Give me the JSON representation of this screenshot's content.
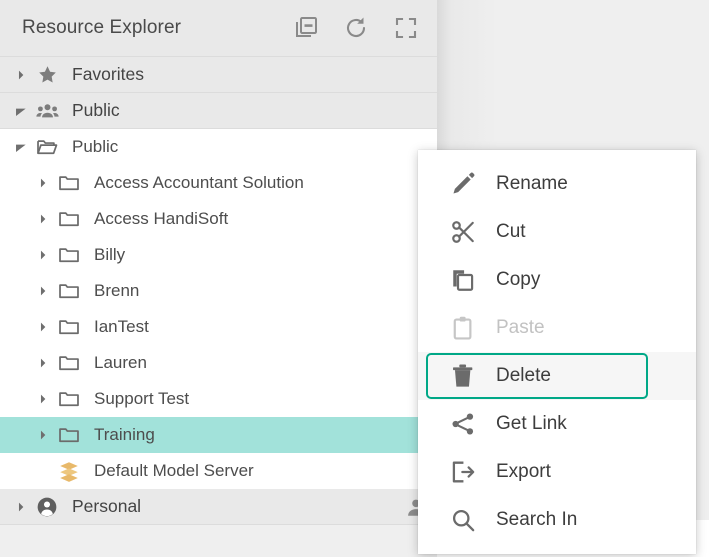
{
  "panel": {
    "title": "Resource Explorer",
    "tools": [
      {
        "name": "collapse-all-icon",
        "label": "Collapse All"
      },
      {
        "name": "refresh-icon",
        "label": "Refresh"
      },
      {
        "name": "fullscreen-icon",
        "label": "Full Screen"
      }
    ]
  },
  "tree": [
    {
      "label": "Favorites",
      "icon": "star-icon",
      "level": 0,
      "expanded": false,
      "has_twisty": true,
      "selected": false
    },
    {
      "label": "Public",
      "icon": "group-icon",
      "level": 0,
      "expanded": true,
      "has_twisty": true,
      "selected": false
    },
    {
      "label": "Public",
      "icon": "folder-open-icon",
      "level": 1,
      "expanded": true,
      "has_twisty": true,
      "selected": false
    },
    {
      "label": "Access Accountant Solution",
      "icon": "folder-icon",
      "level": 2,
      "expanded": false,
      "has_twisty": true,
      "selected": false
    },
    {
      "label": "Access HandiSoft",
      "icon": "folder-icon",
      "level": 2,
      "expanded": false,
      "has_twisty": true,
      "selected": false
    },
    {
      "label": "Billy",
      "icon": "folder-icon",
      "level": 2,
      "expanded": false,
      "has_twisty": true,
      "selected": false
    },
    {
      "label": "Brenn",
      "icon": "folder-icon",
      "level": 2,
      "expanded": false,
      "has_twisty": true,
      "selected": false
    },
    {
      "label": "IanTest",
      "icon": "folder-icon",
      "level": 2,
      "expanded": false,
      "has_twisty": true,
      "selected": false
    },
    {
      "label": "Lauren",
      "icon": "folder-icon",
      "level": 2,
      "expanded": false,
      "has_twisty": true,
      "selected": false
    },
    {
      "label": "Support Test",
      "icon": "folder-icon",
      "level": 2,
      "expanded": false,
      "has_twisty": true,
      "selected": false
    },
    {
      "label": "Training",
      "icon": "folder-icon",
      "level": 2,
      "expanded": false,
      "has_twisty": true,
      "selected": true
    },
    {
      "label": "Default Model Server",
      "icon": "model-server-icon",
      "level": 2,
      "expanded": false,
      "has_twisty": false,
      "selected": false
    },
    {
      "label": "Personal",
      "icon": "person-icon",
      "level": 0,
      "expanded": false,
      "has_twisty": true,
      "selected": false,
      "right_icon": "person-icon"
    }
  ],
  "context_menu": [
    {
      "label": "Rename",
      "icon": "pencil-icon",
      "disabled": false,
      "focused": false
    },
    {
      "label": "Cut",
      "icon": "scissors-icon",
      "disabled": false,
      "focused": false
    },
    {
      "label": "Copy",
      "icon": "copy-icon",
      "disabled": false,
      "focused": false
    },
    {
      "label": "Paste",
      "icon": "clipboard-icon",
      "disabled": true,
      "focused": false
    },
    {
      "label": "Delete",
      "icon": "trash-icon",
      "disabled": false,
      "focused": true
    },
    {
      "label": "Get Link",
      "icon": "share-icon",
      "disabled": false,
      "focused": false
    },
    {
      "label": "Export",
      "icon": "export-icon",
      "disabled": false,
      "focused": false
    },
    {
      "label": "Search In",
      "icon": "search-icon",
      "disabled": false,
      "focused": false
    }
  ],
  "colors": {
    "selection": "#a2e2da",
    "focus_ring": "#00a887",
    "header_bg": "#e9e9e9",
    "panel_bg": "#ffffff",
    "page_bg": "#efefef",
    "icon_gray": "#6b6b6b",
    "text": "#4d4d4d",
    "model_server": "#e8b96a"
  }
}
